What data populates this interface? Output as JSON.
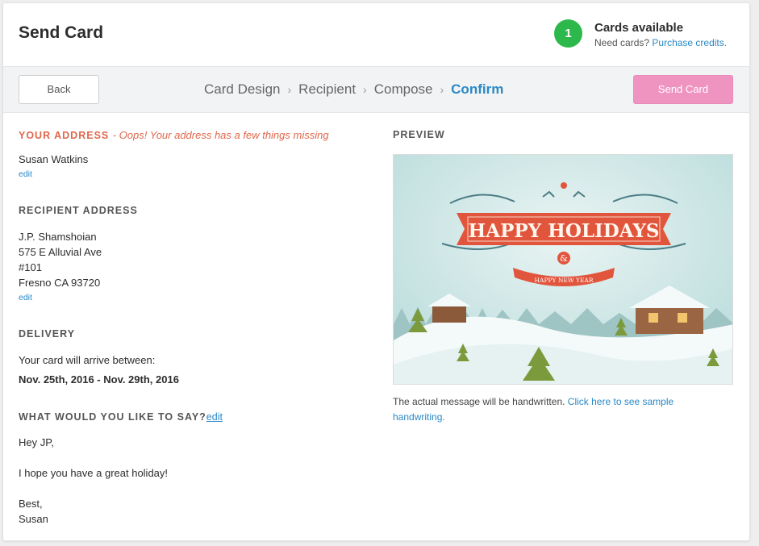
{
  "header": {
    "title": "Send Card",
    "credits_count": "1",
    "credits_title": "Cards available",
    "credits_prompt": "Need cards?",
    "credits_link": "Purchase credits."
  },
  "stepbar": {
    "back_label": "Back",
    "steps": [
      "Card Design",
      "Recipient",
      "Compose",
      "Confirm"
    ],
    "active_step": "Confirm",
    "send_label": "Send Card"
  },
  "your_address": {
    "title": "YOUR ADDRESS",
    "warning": "- Oops! Your address has a few things missing",
    "name": "Susan Watkins",
    "edit": "edit"
  },
  "recipient": {
    "title": "RECIPIENT ADDRESS",
    "lines": [
      "J.P. Shamshoian",
      "575 E Alluvial Ave",
      "#101",
      "Fresno CA 93720"
    ],
    "edit": "edit"
  },
  "delivery": {
    "title": "DELIVERY",
    "text": "Your card will arrive between:",
    "dates": "Nov. 25th, 2016 - Nov. 29th, 2016"
  },
  "message": {
    "title": "WHAT WOULD YOU LIKE TO SAY?",
    "edit": "edit",
    "lines": [
      "Hey JP,",
      "I hope you have a great holiday!",
      "Best,",
      "Susan"
    ]
  },
  "preview": {
    "title": "PREVIEW",
    "card_text": "HAPPY HOLIDAYS",
    "card_ampersand": "&",
    "card_subtext": "HAPPY NEW YEAR",
    "note": "The actual message will be handwritten.",
    "note_link": "Click here to see sample handwriting."
  },
  "colors": {
    "accent_blue": "#2a89c6",
    "badge_green": "#2db84c",
    "send_pink": "#ef94c1",
    "warning_red": "#e0674b"
  }
}
